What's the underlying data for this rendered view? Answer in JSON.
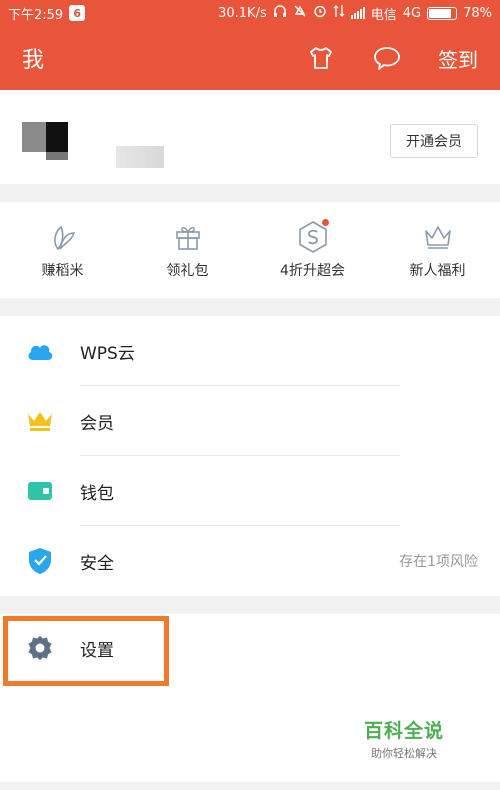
{
  "status_bar": {
    "time": "下午2:59",
    "app_badge": "6",
    "speed": "30.1K/s",
    "carrier": "电信",
    "network": "4G",
    "battery": "78%"
  },
  "header": {
    "title": "我",
    "shirt_icon": "tshirt-icon",
    "message_icon": "chat-bubble-icon",
    "sign_in": "签到"
  },
  "profile": {
    "vip_button": "开通会员"
  },
  "quick_actions": [
    {
      "label": "赚稻米",
      "icon": "leaf-icon"
    },
    {
      "label": "领礼包",
      "icon": "gift-icon"
    },
    {
      "label": "4折升超会",
      "icon": "hexagon-s-icon"
    },
    {
      "label": "新人福利",
      "icon": "crown-outline-icon"
    }
  ],
  "menu": [
    {
      "label": "WPS云",
      "right": "",
      "icon": "cloud-icon"
    },
    {
      "label": "会员",
      "right": "",
      "icon": "crown-icon"
    },
    {
      "label": "钱包",
      "right": "",
      "icon": "wallet-icon"
    },
    {
      "label": "安全",
      "right": "存在1项风险",
      "icon": "shield-icon"
    }
  ],
  "settings": {
    "label": "设置",
    "icon": "gear-icon"
  },
  "watermark": {
    "title": "百科全说",
    "subtitle": "助你轻松解决"
  },
  "colors": {
    "brand": "#e8553a",
    "highlight": "#f07a2a",
    "watermark": "#4caf50"
  }
}
